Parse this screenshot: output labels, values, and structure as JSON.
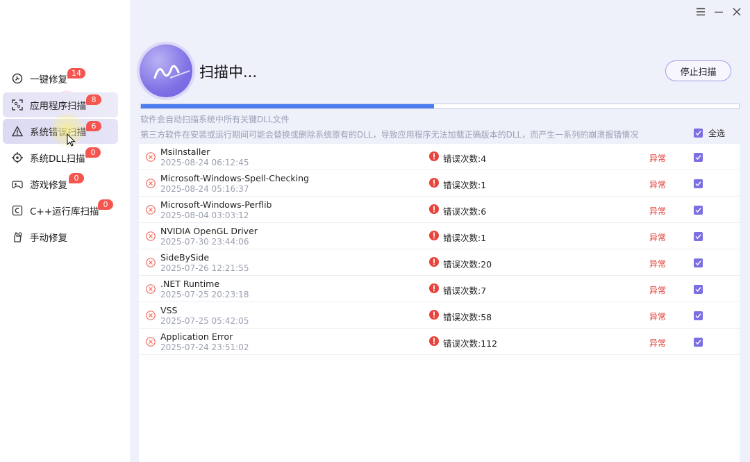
{
  "window": {
    "menu_icon": "hamburger-icon",
    "minimize_icon": "minimize-icon",
    "close_icon": "close-icon"
  },
  "sidebar": {
    "items": [
      {
        "label": "一键修复",
        "badge": "14",
        "icon": "wrench-icon"
      },
      {
        "label": "应用程序扫描",
        "badge": "8",
        "icon": "scan-icon"
      },
      {
        "label": "系统错误扫描",
        "badge": "6",
        "icon": "warning-triangle-icon"
      },
      {
        "label": "系统DLL扫描",
        "badge": "0",
        "icon": "target-icon"
      },
      {
        "label": "游戏修复",
        "badge": "0",
        "icon": "gamepad-icon"
      },
      {
        "label": "C++运行库扫描",
        "badge": "0",
        "icon": "c-box-icon"
      },
      {
        "label": "手动修复",
        "badge": "",
        "icon": "hand-tool-icon"
      }
    ]
  },
  "header": {
    "title": "扫描中...",
    "stop_label": "停止扫描"
  },
  "progress": {
    "fraction": 0.49
  },
  "hints": {
    "line1": "软件会自动扫描系统中所有关键DLL文件",
    "line2": "第三方软件在安装或运行期间可能会替换或删除系统原有的DLL，导致应用程序无法加载正确版本的DLL，而产生一系列的崩溃报错情况"
  },
  "select_all_label": "全选",
  "colors": {
    "accent": "#7b6fe3",
    "progress": "#4d7ef0",
    "error": "#e03c35",
    "badge": "#f4554f"
  },
  "rows": [
    {
      "name": "MsiInstaller",
      "time": "2025-08-24 06:12:45",
      "errors": "错误次数:4",
      "status": "异常"
    },
    {
      "name": "Microsoft-Windows-Spell-Checking",
      "time": "2025-08-24 05:16:37",
      "errors": "错误次数:1",
      "status": "异常"
    },
    {
      "name": "Microsoft-Windows-Perflib",
      "time": "2025-08-04 03:03:12",
      "errors": "错误次数:6",
      "status": "异常"
    },
    {
      "name": "NVIDIA OpenGL Driver",
      "time": "2025-07-30 23:44:06",
      "errors": "错误次数:1",
      "status": "异常"
    },
    {
      "name": "SideBySide",
      "time": "2025-07-26 12:21:55",
      "errors": "错误次数:20",
      "status": "异常"
    },
    {
      "name": ".NET Runtime",
      "time": "2025-07-25 20:23:18",
      "errors": "错误次数:7",
      "status": "异常"
    },
    {
      "name": "VSS",
      "time": "2025-07-25 05:42:05",
      "errors": "错误次数:58",
      "status": "异常"
    },
    {
      "name": "Application Error",
      "time": "2025-07-24 23:51:02",
      "errors": "错误次数:112",
      "status": "异常"
    }
  ]
}
